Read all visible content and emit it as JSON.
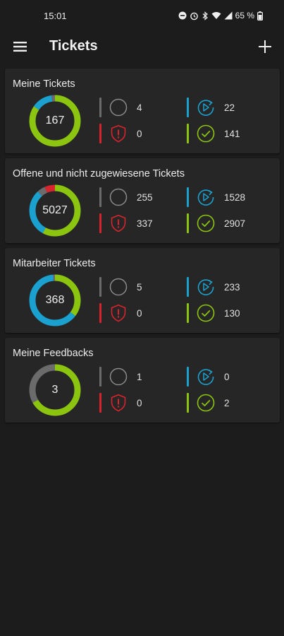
{
  "status_bar": {
    "time": "15:01",
    "battery": "65 %"
  },
  "app_bar": {
    "title": "Tickets"
  },
  "colors": {
    "background": "#1c1c1c",
    "card": "#262626",
    "open": "#6b6b6b",
    "in_progress": "#1aa1cf",
    "escalated": "#d8242c",
    "done": "#8cc510"
  },
  "cards": [
    {
      "title": "Meine Tickets",
      "total": "167",
      "open": "4",
      "in_progress": "22",
      "escalated": "0",
      "done": "141"
    },
    {
      "title": "Offene und nicht zugewiesene Tickets",
      "total": "5027",
      "open": "255",
      "in_progress": "1528",
      "escalated": "337",
      "done": "2907"
    },
    {
      "title": "Mitarbeiter Tickets",
      "total": "368",
      "open": "5",
      "in_progress": "233",
      "escalated": "0",
      "done": "130"
    },
    {
      "title": "Meine Feedbacks",
      "total": "3",
      "open": "1",
      "in_progress": "0",
      "escalated": "0",
      "done": "2"
    }
  ]
}
